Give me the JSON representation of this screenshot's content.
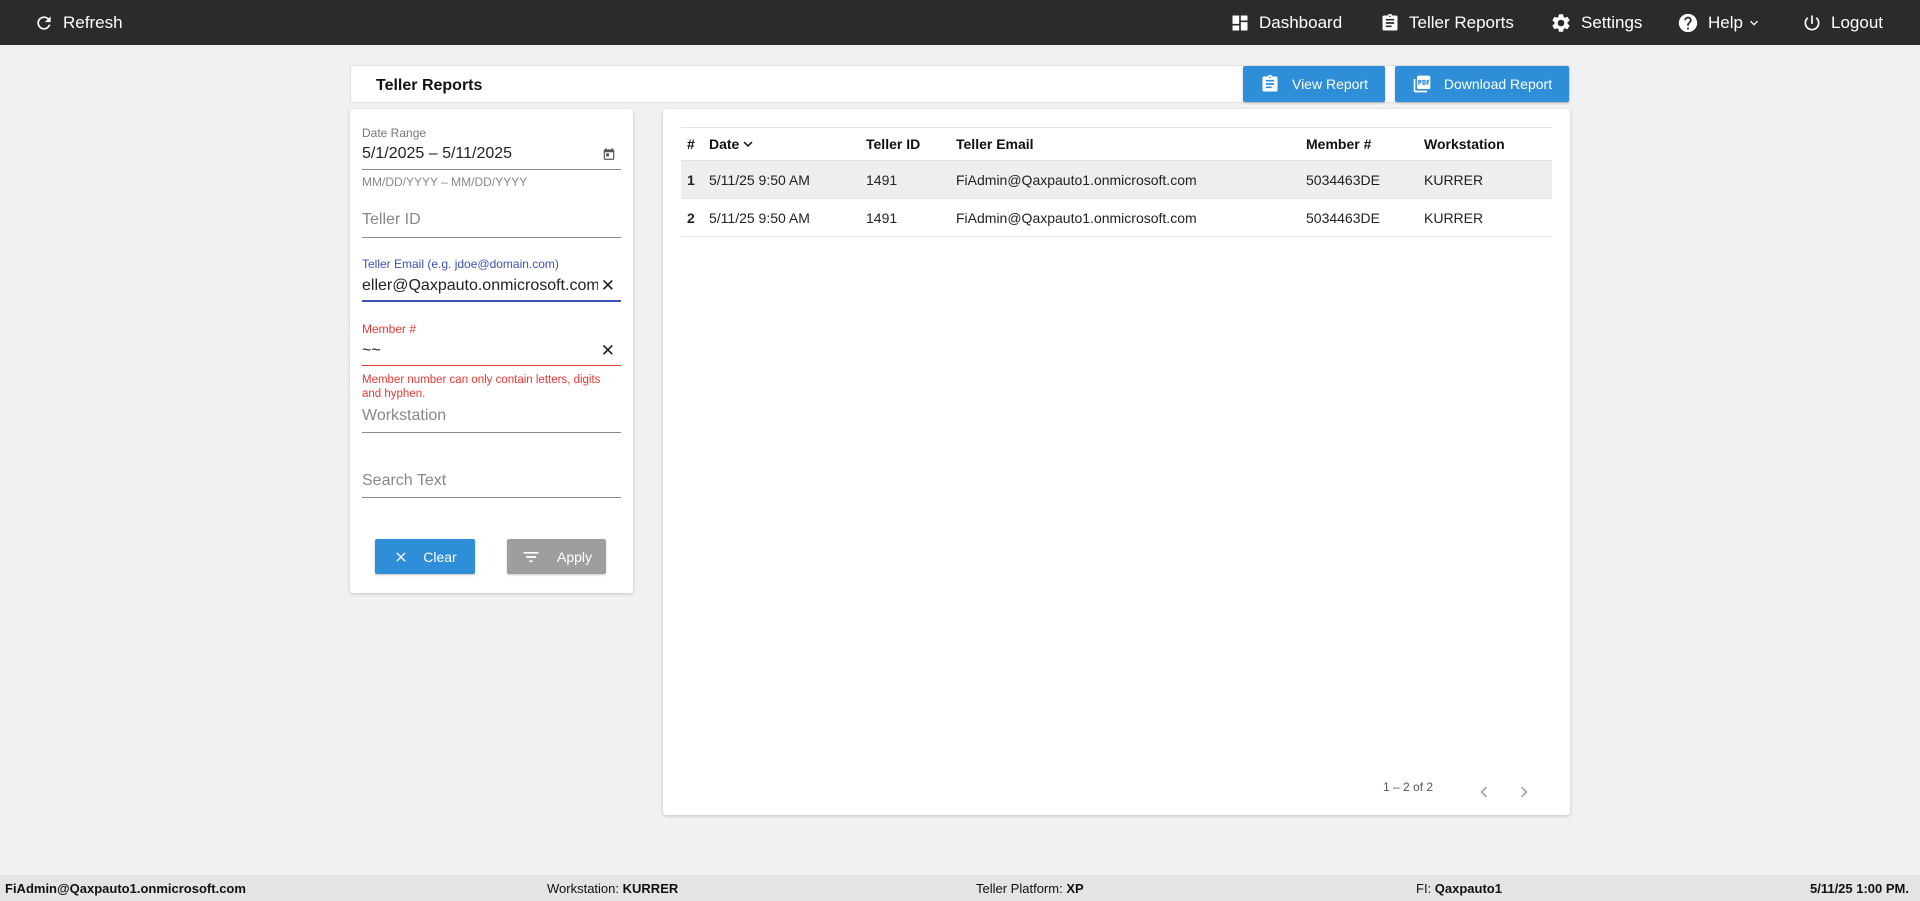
{
  "topbar": {
    "refresh_label": "Refresh",
    "nav": {
      "dashboard": "Dashboard",
      "teller_reports": "Teller Reports",
      "settings": "Settings",
      "help": "Help",
      "logout": "Logout"
    }
  },
  "page": {
    "title": "Teller Reports",
    "view_report_label": "View Report",
    "download_report_label": "Download Report"
  },
  "filters": {
    "date_range": {
      "label": "Date Range",
      "value": "5/1/2025 – 5/11/2025",
      "hint": "MM/DD/YYYY – MM/DD/YYYY"
    },
    "teller_id": {
      "placeholder": "Teller ID"
    },
    "teller_email": {
      "label": "Teller Email (e.g. jdoe@domain.com)",
      "value": "eller@Qaxpauto.onmicrosoft.com"
    },
    "member": {
      "label": "Member #",
      "value": "~~",
      "error": "Member number can only contain letters, digits and hyphen."
    },
    "workstation": {
      "placeholder": "Workstation"
    },
    "search_text": {
      "placeholder": "Search Text"
    },
    "clear_label": "Clear",
    "apply_label": "Apply"
  },
  "table": {
    "columns": [
      "#",
      "Date",
      "Teller ID",
      "Teller Email",
      "Member #",
      "Workstation"
    ],
    "rows": [
      [
        "1",
        "5/11/25 9:50 AM",
        "1491",
        "FiAdmin@Qaxpauto1.onmicrosoft.com",
        "5034463DE",
        "KURRER"
      ],
      [
        "2",
        "5/11/25 9:50 AM",
        "1491",
        "FiAdmin@Qaxpauto1.onmicrosoft.com",
        "5034463DE",
        "KURRER"
      ]
    ],
    "pagination": "1 – 2 of 2"
  },
  "footer": {
    "user": "FiAdmin@Qaxpauto1.onmicrosoft.com",
    "workstation_label": "Workstation:",
    "workstation_value": "KURRER",
    "platform_label": "Teller Platform:",
    "platform_value": "XP",
    "fi_label": "FI:",
    "fi_value": "Qaxpauto1",
    "datetime": "5/11/25 1:00 PM."
  },
  "colors": {
    "topbar": "#2b2b2b",
    "primary": "#2f8ed8",
    "error": "#e53935",
    "focus": "#3f51b5"
  }
}
